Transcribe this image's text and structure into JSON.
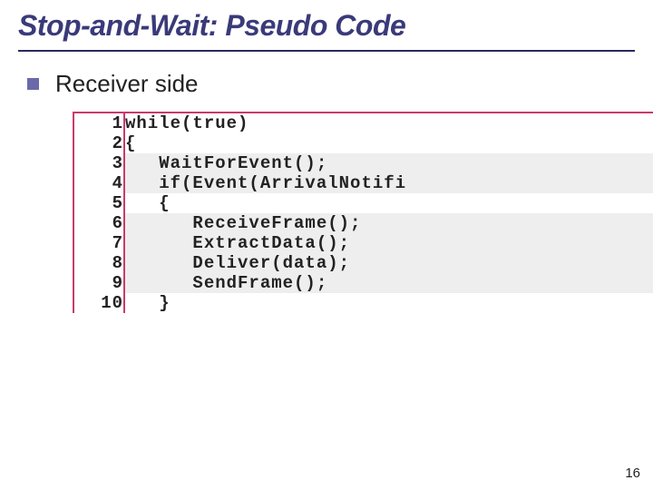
{
  "slide": {
    "title": "Stop-and-Wait: Pseudo Code",
    "bullet_text": "Receiver side",
    "page_number": "16"
  },
  "code": {
    "lines": [
      {
        "num": "1",
        "text": "while(true)",
        "shaded": false
      },
      {
        "num": "2",
        "text": "{",
        "shaded": false
      },
      {
        "num": "3",
        "text": "   WaitForEvent();",
        "shaded": true
      },
      {
        "num": "4",
        "text": "   if(Event(ArrivalNotifi",
        "shaded": true
      },
      {
        "num": "5",
        "text": "   {",
        "shaded": false
      },
      {
        "num": "6",
        "text": "      ReceiveFrame();",
        "shaded": true
      },
      {
        "num": "7",
        "text": "      ExtractData();",
        "shaded": true
      },
      {
        "num": "8",
        "text": "      Deliver(data);",
        "shaded": true
      },
      {
        "num": "9",
        "text": "      SendFrame();",
        "shaded": true
      },
      {
        "num": "10",
        "text": "   }",
        "shaded": false
      }
    ]
  }
}
